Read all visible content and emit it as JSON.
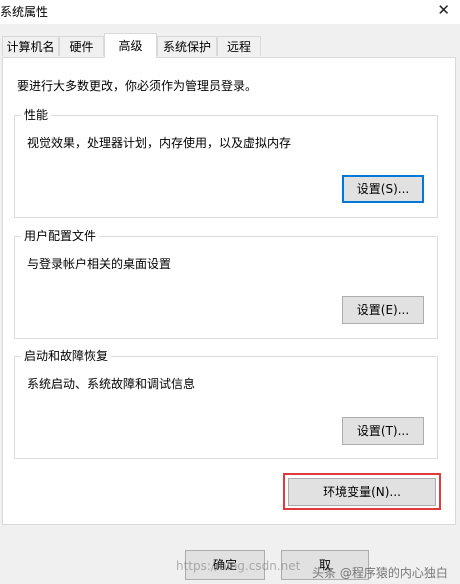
{
  "window": {
    "title": "系统属性",
    "close_glyph": "✕"
  },
  "tabs": [
    {
      "label": "计算机名",
      "active": false
    },
    {
      "label": "硬件",
      "active": false
    },
    {
      "label": "高级",
      "active": true
    },
    {
      "label": "系统保护",
      "active": false
    },
    {
      "label": "远程",
      "active": false
    }
  ],
  "intro": "要进行大多数更改，你必须作为管理员登录。",
  "performance": {
    "label": "性能",
    "desc": "视觉效果，处理器计划，内存使用，以及虚拟内存",
    "button": "设置(S)..."
  },
  "user_profiles": {
    "label": "用户配置文件",
    "desc": "与登录帐户相关的桌面设置",
    "button": "设置(E)..."
  },
  "startup": {
    "label": "启动和故障恢复",
    "desc": "系统启动、系统故障和调试信息",
    "button": "设置(T)..."
  },
  "env_button": "环境变量(N)...",
  "footer": {
    "ok": "确定",
    "cancel": "取"
  },
  "watermark": {
    "left": "https://blog.csdn.net",
    "right": "头条 @程序猿的内心独白"
  }
}
